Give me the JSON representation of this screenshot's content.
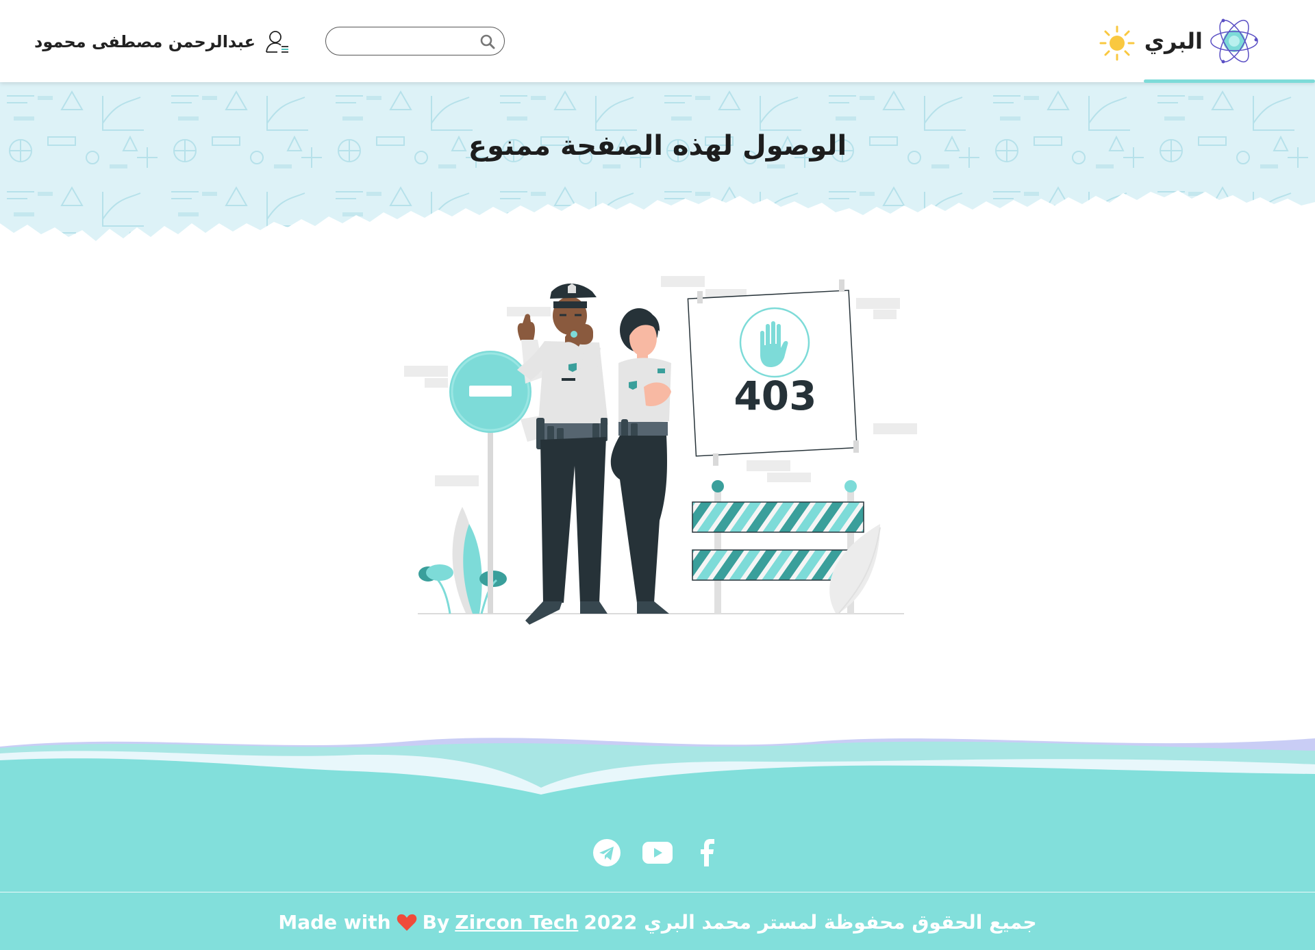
{
  "navbar": {
    "brand_name": "البري",
    "user_name": "عبدالرحمن مصطفى محمود",
    "search": {
      "placeholder": "",
      "value": ""
    },
    "icons": {
      "logo": "atom-logo-icon",
      "theme": "sun-icon",
      "search": "search-icon",
      "user": "user-list-icon"
    }
  },
  "hero": {
    "title": "الوصول لهذه الصفحة ممنوع"
  },
  "illustration": {
    "error_code": "403",
    "icon": "stop-hand-icon"
  },
  "footer": {
    "social": [
      {
        "name": "telegram",
        "icon": "telegram-icon"
      },
      {
        "name": "youtube",
        "icon": "youtube-icon"
      },
      {
        "name": "facebook",
        "icon": "facebook-icon"
      }
    ],
    "made_with": "Made with",
    "by": "By",
    "company": "Zircon Tech",
    "copyright": "جميع الحقوق محفوظة لمستر محمد البري 2022"
  },
  "colors": {
    "accent": "#82dfdb",
    "hero_bg": "#dff3f8",
    "heart": "#f04b3a",
    "sun": "#f9c840",
    "text": "#1d1d1d"
  }
}
